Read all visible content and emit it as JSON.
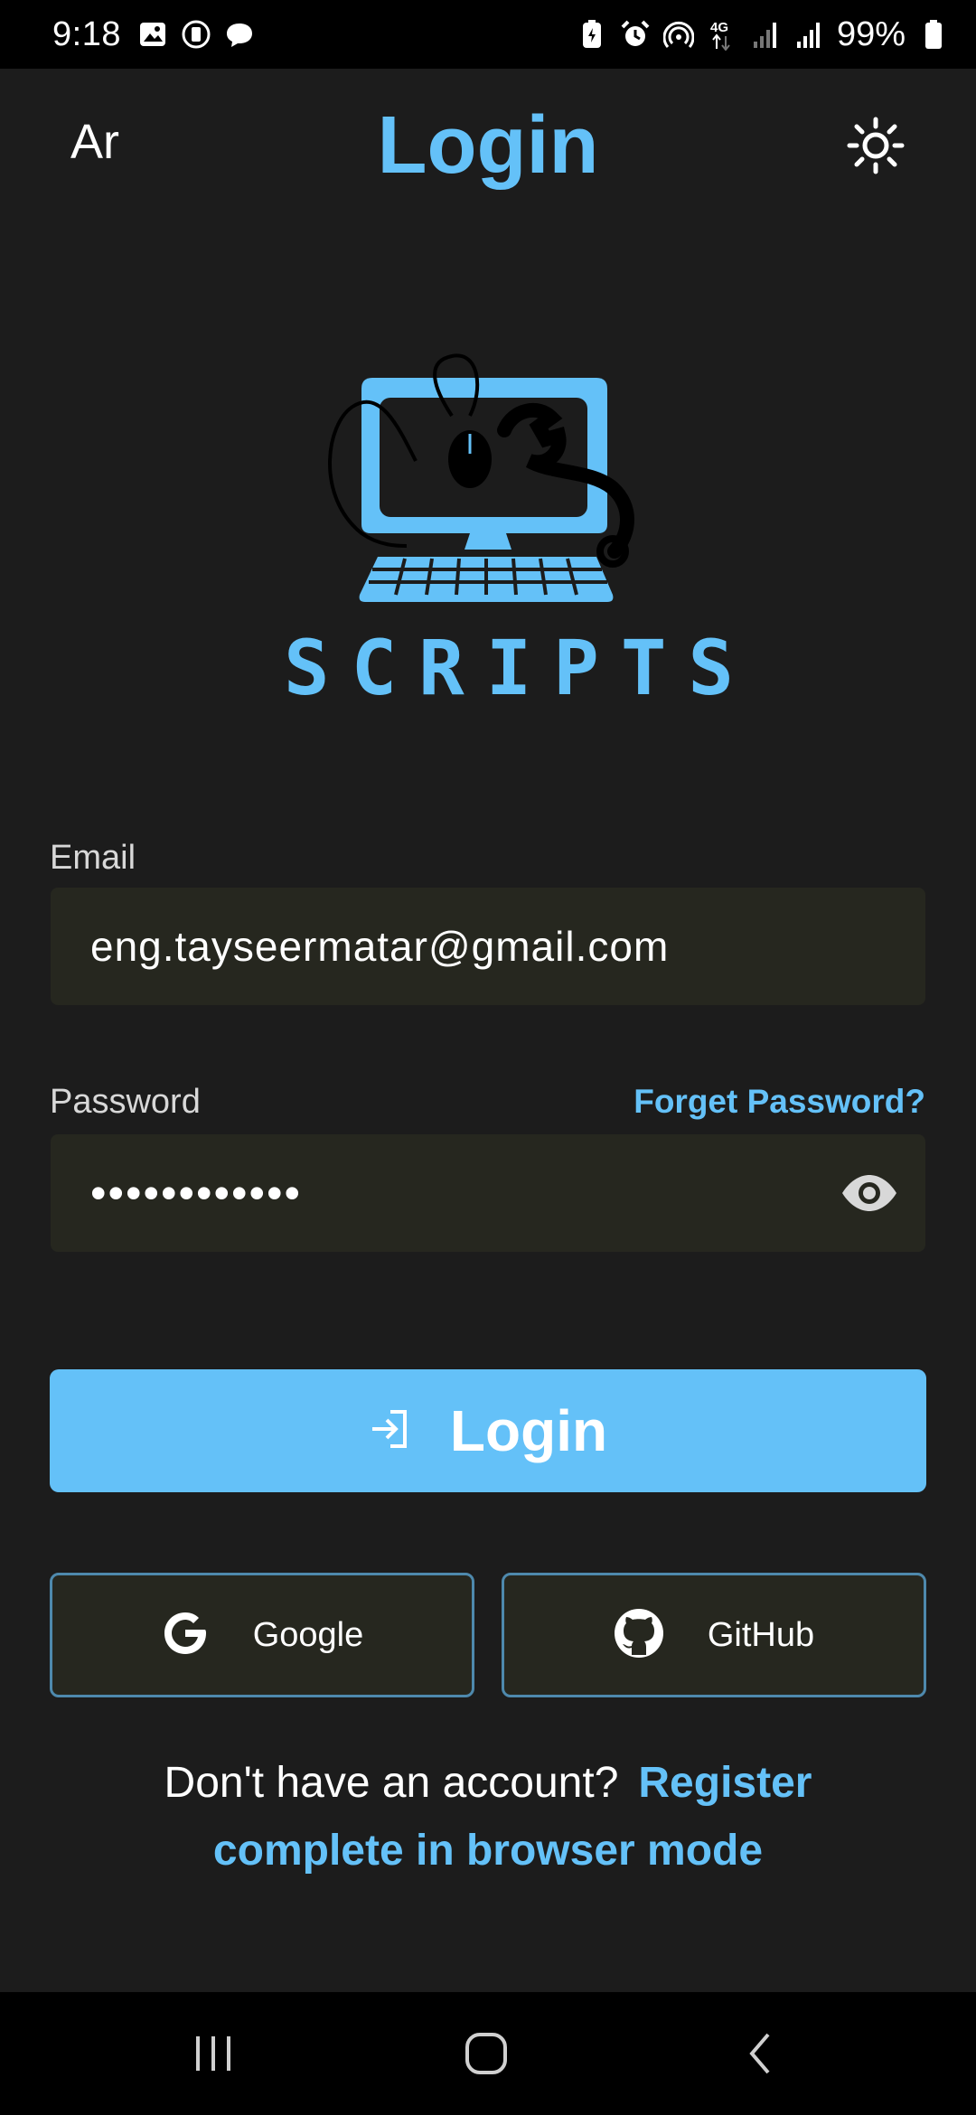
{
  "status_bar": {
    "time": "9:18",
    "battery": "99%",
    "network": "4G",
    "left_icons": [
      "gallery-icon",
      "screenshot-icon",
      "chat-bubble-icon"
    ],
    "right_icons": [
      "battery-saver-icon",
      "alarm-icon",
      "hotspot-icon",
      "network-4g-icon",
      "signal-icon",
      "signal-icon",
      "battery-icon"
    ]
  },
  "app_bar": {
    "language": "Ar",
    "title": "Login",
    "theme_icon": "sun-icon"
  },
  "logo": {
    "text": "SCRIPTS",
    "icon": "computer-mouse-wrench-logo"
  },
  "form": {
    "email_label": "Email",
    "email_value": "eng.tayseermatar@gmail.com",
    "password_label": "Password",
    "password_value": "••••••••••••",
    "forgot_label": "Forget Password?",
    "eye_icon": "eye-icon"
  },
  "login_button": {
    "label": "Login",
    "icon": "login-arrow-icon"
  },
  "social": {
    "google_label": "Google",
    "github_label": "GitHub"
  },
  "register": {
    "prompt": "Don't have an account?",
    "link": "Register",
    "note": "complete in browser mode"
  },
  "nav_bar": {
    "icons": [
      "recents-icon",
      "home-icon",
      "back-icon"
    ]
  },
  "colors": {
    "accent": "#64c1f8",
    "background": "#1c1c1c",
    "input_bg": "#26271f",
    "social_border": "#4e89ad"
  }
}
